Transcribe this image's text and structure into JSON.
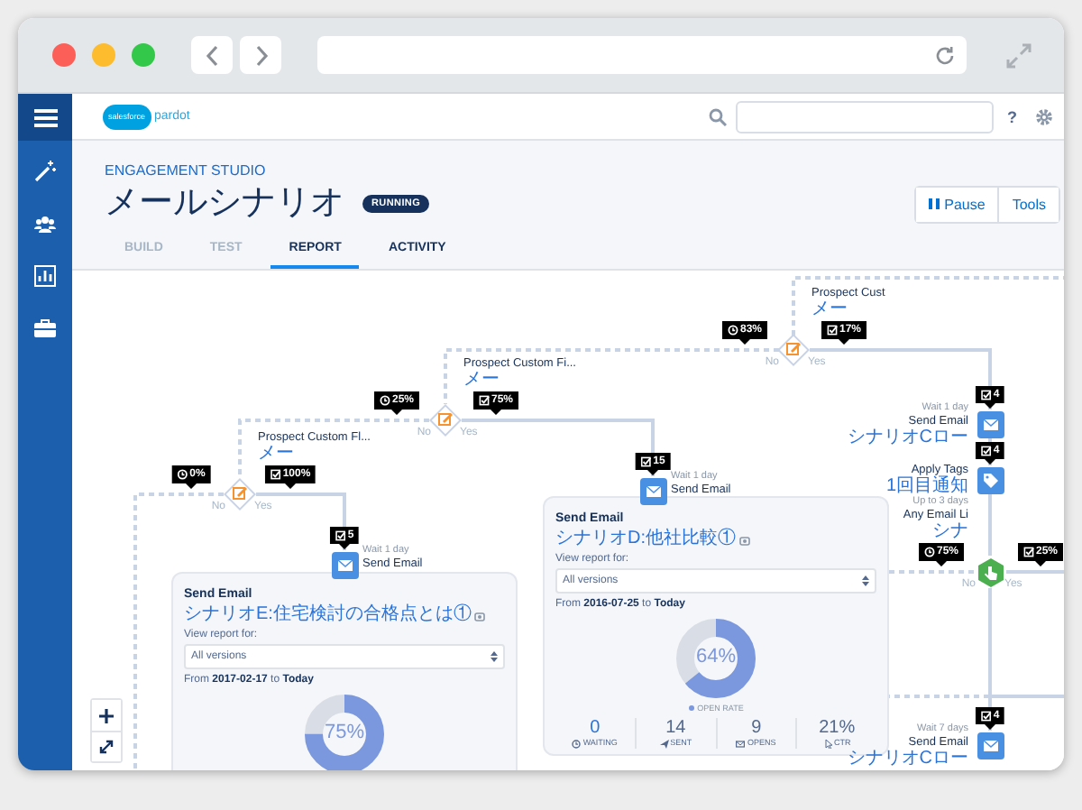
{
  "logo": {
    "brand": "salesforce",
    "product": "pardot"
  },
  "help": "?",
  "page": {
    "breadcrumb": "ENGAGEMENT STUDIO",
    "title": "メールシナリオ",
    "status": "RUNNING",
    "buttons": [
      {
        "kind": "pause",
        "label": "Pause"
      },
      {
        "kind": "plain",
        "label": "Tools"
      }
    ]
  },
  "tabs": [
    {
      "label": "BUILD",
      "selected": false,
      "disabled": true
    },
    {
      "label": "TEST",
      "selected": false,
      "disabled": true
    },
    {
      "label": "REPORT",
      "selected": true,
      "disabled": false
    },
    {
      "label": "ACTIVITY",
      "selected": false,
      "disabled": false
    }
  ],
  "flow": {
    "nodes": [
      {
        "kind": "decision",
        "title": "Prospect Cust",
        "subtitle": "メー",
        "badges": [
          {
            "kind": "clock",
            "text": "83%"
          },
          {
            "kind": "check",
            "text": "17%"
          }
        ],
        "branches": [
          "No",
          "Yes"
        ]
      },
      {
        "kind": "decision",
        "title": "Prospect Custom Fi...",
        "subtitle": "メー",
        "badges": [
          {
            "kind": "clock",
            "text": "25%"
          },
          {
            "kind": "check",
            "text": "75%"
          }
        ],
        "branches": [
          "No",
          "Yes"
        ]
      },
      {
        "kind": "email",
        "caption": "Wait 1 day",
        "title": "Send Email",
        "subtitle": "シナリオCロー",
        "badges": [
          {
            "kind": "check",
            "text": "4"
          }
        ]
      },
      {
        "kind": "decision",
        "title": "Prospect Custom Fl...",
        "subtitle": "メー",
        "badges": [
          {
            "kind": "clock",
            "text": "0%"
          },
          {
            "kind": "check",
            "text": "100%"
          }
        ],
        "branches": [
          "No",
          "Yes"
        ]
      },
      {
        "kind": "email",
        "caption": "Wait 1 day",
        "title": "Send Email",
        "badges": [
          {
            "kind": "check",
            "text": "15"
          }
        ]
      },
      {
        "kind": "tag",
        "title": "Apply Tags",
        "subtitle": "1回目通知",
        "badges": [
          {
            "kind": "check",
            "text": "4"
          }
        ]
      },
      {
        "kind": "email",
        "caption": "Wait 1 day",
        "title": "Send Email",
        "badges": [
          {
            "kind": "check",
            "text": "5"
          }
        ]
      },
      {
        "kind": "listener",
        "caption": "Up to 3 days",
        "title": "Any Email Li",
        "subtitle": "シナ",
        "badges": [
          {
            "kind": "clock",
            "text": "75%"
          },
          {
            "kind": "check",
            "text": "25%"
          }
        ],
        "branches": [
          "No",
          "Yes"
        ]
      },
      {
        "kind": "email",
        "caption": "Wait 7 days",
        "title": "Send Email",
        "subtitle": "シナリオCロー",
        "badges": [
          {
            "kind": "check",
            "text": "4"
          }
        ]
      }
    ],
    "report_cards": [
      {
        "title": "Send Email",
        "link": "シナリオE:住宅検討の合格点とは①",
        "filter_label": "View report for:",
        "filter_value": "All versions",
        "date_range": "From **2017-02-17** to **Today**",
        "level": 0.75,
        "percent": "75%"
      },
      {
        "title": "Send Email",
        "link": "シナリオD:他社比較①",
        "filter_label": "View report for:",
        "filter_value": "All versions",
        "date_range": "From **2016-07-25** to **Today**",
        "level": 0.64,
        "percent": "64%",
        "legend": "OPEN RATE",
        "stats": [
          {
            "kind": "waiting",
            "value": "0",
            "label": "WAITING"
          },
          {
            "kind": "sent",
            "value": "14",
            "label": "SENT"
          },
          {
            "kind": "opens",
            "value": "9",
            "label": "OPENS"
          },
          {
            "kind": "ctr",
            "value": "21%",
            "label": "CTR"
          }
        ]
      }
    ]
  }
}
